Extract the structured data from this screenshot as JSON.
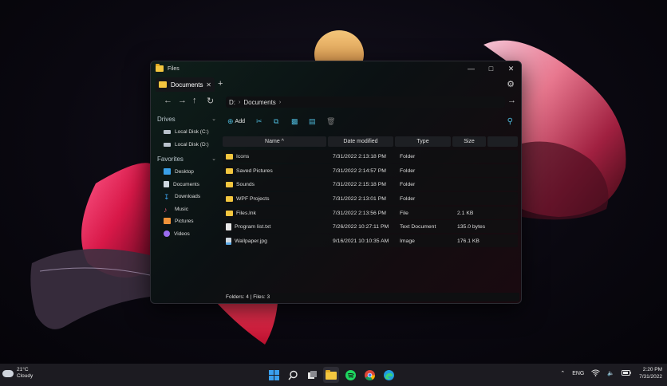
{
  "window": {
    "title": "Files"
  },
  "tabs": [
    {
      "label": "Documents"
    }
  ],
  "address": {
    "drive": "D:",
    "folder": "Documents"
  },
  "sidebar": {
    "drives_label": "Drives",
    "drives": [
      "Local Disk (C:)",
      "Local Disk (D:)"
    ],
    "favorites_label": "Favorites",
    "favorites": [
      {
        "label": "Desktop",
        "icon": "desktop-icon",
        "color": "#3aa0e8"
      },
      {
        "label": "Documents",
        "icon": "documents-icon",
        "color": "#cfd8e0"
      },
      {
        "label": "Downloads",
        "icon": "downloads-icon",
        "color": "#3aa0e8"
      },
      {
        "label": "Music",
        "icon": "music-icon",
        "color": "#e85b76"
      },
      {
        "label": "Pictures",
        "icon": "pictures-icon",
        "color": "#f0923a"
      },
      {
        "label": "Videos",
        "icon": "videos-icon",
        "color": "#9b6cf0"
      }
    ]
  },
  "toolbar": {
    "add_label": "Add"
  },
  "table": {
    "columns": [
      "Name ^",
      "Date modified",
      "Type",
      "Size"
    ],
    "rows": [
      {
        "name": "Icons",
        "date": "7/31/2022 2:13:18 PM",
        "type": "Folder",
        "size": "",
        "kind": "folder"
      },
      {
        "name": "Saved Pictures",
        "date": "7/31/2022 2:14:57 PM",
        "type": "Folder",
        "size": "",
        "kind": "folder"
      },
      {
        "name": "Sounds",
        "date": "7/31/2022 2:15:18 PM",
        "type": "Folder",
        "size": "",
        "kind": "folder"
      },
      {
        "name": "WPF Projects",
        "date": "7/31/2022 2:13:01 PM",
        "type": "Folder",
        "size": "",
        "kind": "folder"
      },
      {
        "name": "Files.lnk",
        "date": "7/31/2022 2:13:56 PM",
        "type": "File",
        "size": "2.1 KB",
        "kind": "folder"
      },
      {
        "name": "Program list.txt",
        "date": "7/26/2022 10:27:11 PM",
        "type": "Text Document",
        "size": "135.0 bytes",
        "kind": "file"
      },
      {
        "name": "Wallpaper.jpg",
        "date": "9/16/2021 10:10:35 AM",
        "type": "Image",
        "size": "176.1 KB",
        "kind": "image"
      }
    ]
  },
  "status": {
    "text": "Folders: 4 | Files: 3"
  },
  "taskbar": {
    "weather_temp": "21°C",
    "weather_desc": "Cloudy",
    "language": "ENG",
    "time": "2:20 PM",
    "date": "7/31/2022"
  },
  "colors": {
    "accent": "#4db7d8",
    "folder": "#f3c63f"
  }
}
